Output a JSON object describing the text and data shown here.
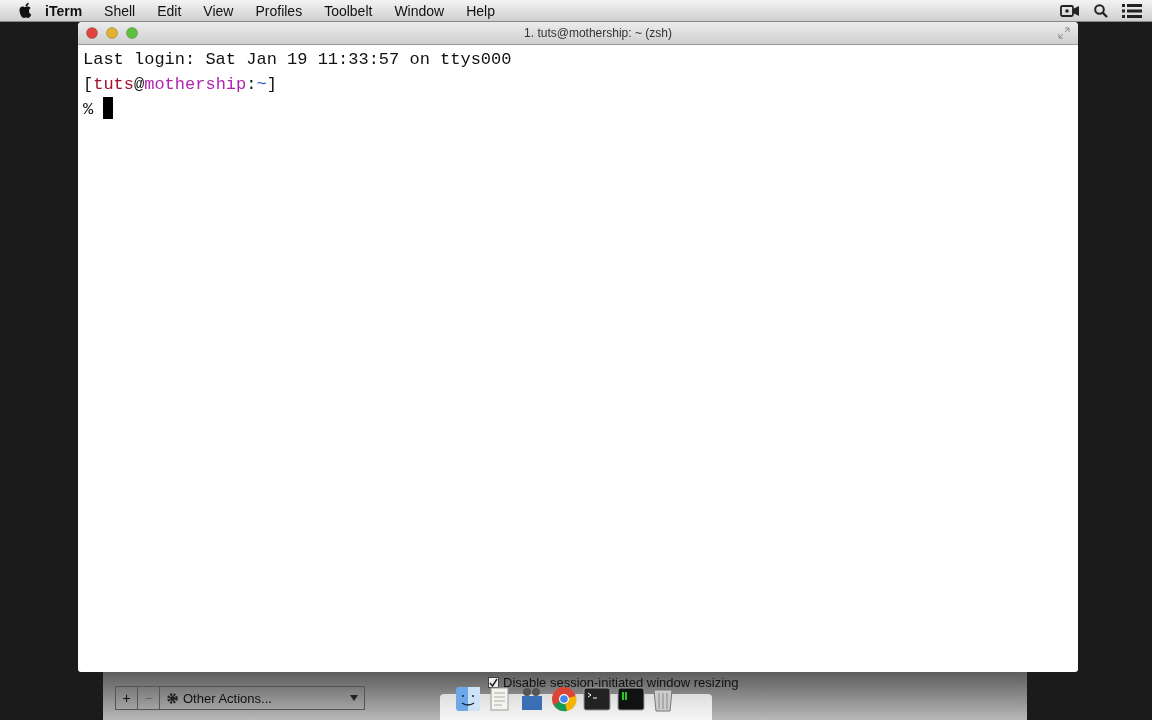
{
  "menu_bar": {
    "app": "iTerm",
    "items": [
      "Shell",
      "Edit",
      "View",
      "Profiles",
      "Toolbelt",
      "Window",
      "Help"
    ]
  },
  "window": {
    "title": "1. tuts@mothership: ~ (zsh)",
    "lines": [
      {
        "kind": "text",
        "text": "Last login: Sat Jan 19 11:33:57 on ttys000"
      },
      {
        "kind": "prompt",
        "open": "[",
        "user": "tuts",
        "at": "@",
        "host": "mothership",
        "sep": ":",
        "path": "~",
        "close": "]"
      },
      {
        "kind": "input",
        "text": "%"
      }
    ]
  },
  "back_panel": {
    "buttons": [
      {
        "label": "+",
        "disabled": false
      },
      {
        "label": "−",
        "disabled": true
      }
    ],
    "actions": "Other Actions...",
    "checkbox": {
      "label": "Disable session-initiated window resizing",
      "checked": true
    }
  }
}
